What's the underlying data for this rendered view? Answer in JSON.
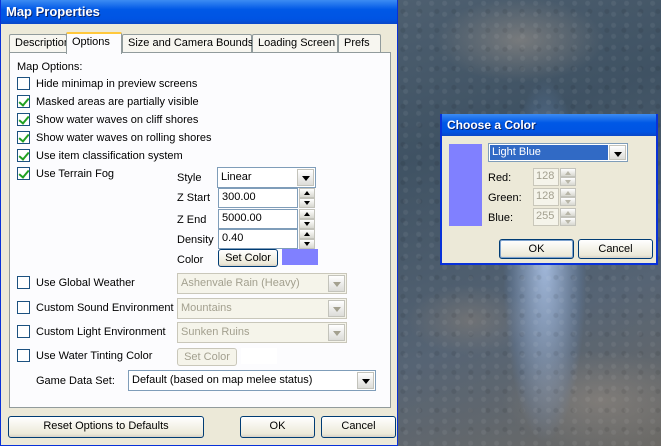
{
  "main_window": {
    "title": "Map Properties",
    "tabs": [
      {
        "label": "Description",
        "active": false
      },
      {
        "label": "Options",
        "active": true
      },
      {
        "label": "Size and Camera Bounds",
        "active": false
      },
      {
        "label": "Loading Screen",
        "active": false
      },
      {
        "label": "Prefs",
        "active": false
      }
    ],
    "section_label": "Map Options:",
    "checkboxes": [
      {
        "label": "Hide minimap in preview screens",
        "checked": false
      },
      {
        "label": "Masked areas are partially visible",
        "checked": true
      },
      {
        "label": "Show water waves on cliff shores",
        "checked": true
      },
      {
        "label": "Show water waves on rolling shores",
        "checked": true
      },
      {
        "label": "Use item classification system",
        "checked": true
      },
      {
        "label": "Use Terrain Fog",
        "checked": true
      }
    ],
    "fog": {
      "style_label": "Style",
      "style_value": "Linear",
      "z_start_label": "Z Start",
      "z_start_value": "300.00",
      "z_end_label": "Z End",
      "z_end_value": "5000.00",
      "density_label": "Density",
      "density_value": "0.40",
      "color_label": "Color",
      "set_color_label": "Set Color",
      "color_hex": "#8080ff"
    },
    "global_weather": {
      "label": "Use Global Weather",
      "checked": false,
      "value": "Ashenvale Rain (Heavy)"
    },
    "sound_env": {
      "label": "Custom Sound Environment",
      "checked": false,
      "value": "Mountains"
    },
    "light_env": {
      "label": "Custom Light Environment",
      "checked": false,
      "value": "Sunken Ruins"
    },
    "water_tint": {
      "label": "Use Water Tinting Color",
      "checked": false,
      "set_color_label": "Set Color",
      "color_hex": "#ffffff"
    },
    "game_data_set": {
      "label": "Game Data Set:",
      "value": "Default (based on map melee status)"
    },
    "buttons": {
      "reset": "Reset Options to Defaults",
      "ok": "OK",
      "cancel": "Cancel"
    }
  },
  "color_dialog": {
    "title": "Choose a Color",
    "preset_value": "Light Blue",
    "preview_hex": "#8080ff",
    "red_label": "Red:",
    "red_value": "128",
    "green_label": "Green:",
    "green_value": "128",
    "blue_label": "Blue:",
    "blue_value": "255",
    "ok_label": "OK",
    "cancel_label": "Cancel"
  },
  "colors": {
    "titlebar": "#0054e3",
    "window_bg": "#ece9d8",
    "check_green": "#21a121"
  }
}
